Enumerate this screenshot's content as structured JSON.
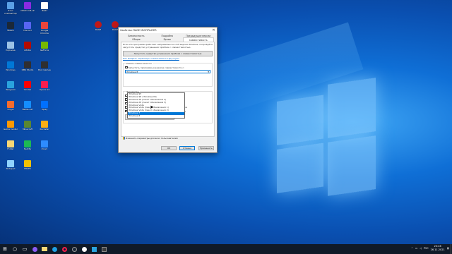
{
  "colors": {
    "accent": "#0078d7",
    "taskbar": "#101a28",
    "wallpaper": "#0a4fb0"
  },
  "desktop_icons": [
    {
      "label": "Этот компьютер",
      "color": "#5aa0e6",
      "icon": "computer-icon"
    },
    {
      "label": "CPUID CPU-Z",
      "color": "#8a2be2",
      "icon": "cpuz-icon"
    },
    {
      "label": "Файл",
      "color": "#ffffff",
      "icon": "file-icon"
    },
    {
      "label": "Steam",
      "color": "#1b2838",
      "icon": "steam-icon"
    },
    {
      "label": "Discord",
      "color": "#5865f2",
      "icon": "discord-icon"
    },
    {
      "label": "Google Chrome",
      "color": "#e8453c",
      "icon": "chrome-icon"
    },
    {
      "label": "Корзина",
      "color": "#9cc3e6",
      "icon": "recycle-bin-icon"
    },
    {
      "label": "Adobe",
      "color": "#b30b00",
      "icon": "adobe-icon"
    },
    {
      "label": "GeForce",
      "color": "#76b900",
      "icon": "nvidia-icon"
    },
    {
      "label": "Windows",
      "color": "#0078d7",
      "icon": "windows-icon"
    },
    {
      "label": "OBS Studio",
      "color": "#302e31",
      "icon": "obs-icon"
    },
    {
      "label": "Epic Games",
      "color": "#2f2f2f",
      "icon": "epic-icon"
    },
    {
      "label": "Telegram",
      "color": "#2aa3de",
      "icon": "telegram-icon"
    },
    {
      "label": "Yandex",
      "color": "#ff0000",
      "icon": "yandex-icon"
    },
    {
      "label": "Opera GX",
      "color": "#fa1e4e",
      "icon": "opera-icon"
    },
    {
      "label": "Origin",
      "color": "#f56c2d",
      "icon": "origin-icon"
    },
    {
      "label": "Battle.net",
      "color": "#148eff",
      "icon": "battlenet-icon"
    },
    {
      "label": "Uplay",
      "color": "#0070ff",
      "icon": "uplay-icon"
    },
    {
      "label": "Game Center",
      "color": "#ff9900",
      "icon": "gamecenter-icon"
    },
    {
      "label": "Minecraft",
      "color": "#5b8731",
      "icon": "minecraft-icon"
    },
    {
      "label": "Rockstar",
      "color": "#fcaf17",
      "icon": "rockstar-icon"
    },
    {
      "label": "Folder",
      "color": "#f8d775",
      "icon": "folder-icon"
    },
    {
      "label": "Spotify",
      "color": "#1db954",
      "icon": "spotify-icon"
    },
    {
      "label": "Zoom",
      "color": "#2d8cff",
      "icon": "zoom-icon"
    },
    {
      "label": "Notepad",
      "color": "#8fd3ff",
      "icon": "notepad-icon"
    },
    {
      "label": "FRAPS",
      "color": "#f2c200",
      "icon": "fraps-icon"
    }
  ],
  "dialog": {
    "title": "Свойства: RAGE MULTIPLAYER",
    "close": "✕",
    "tabs": [
      "Безопасность",
      "Подробно",
      "Предыдущие версии",
      "Общие",
      "Ярлык",
      "Совместимость"
    ],
    "intro": "Если эта программа работает неправильно в этой версии Windows, попробуйте запустить средство устранения проблем с совместимостью.",
    "troubleshoot_button": "Запустить средство устранения проблем с совместимостью",
    "how_link": "Как выбрать параметры совместимости вручную?",
    "group_title": "Режим совместимости",
    "compat_checkbox": "Запустить программу в режиме совместимости с:",
    "compat_check_mark": "✓",
    "selected_os": "Windows 8",
    "dropdown_options": [
      "Windows 95",
      "Windows 98 / Windows Me",
      "Windows XP (пакет обновления 2)",
      "Windows XP (пакет обновления 3)",
      "Windows Vista",
      "Windows Vista (пакет обновления 1)",
      "Windows Vista (пакет обновления 2)",
      "Windows 7",
      "Windows 8"
    ],
    "selected_index": 7,
    "settings_title": "Параметры",
    "options": [
      "Режим пониженной цветности",
      "Использовать разрешение экрана 640 × 480",
      "Отключить оптимизацию во весь экран",
      "Запускать эту программу от имени администратора",
      "Зарегистрировать эту программу для перезапуска"
    ],
    "dpi_button": "Изменить параметры высокого DPI",
    "all_users_button": "Изменить параметры для всех пользователей",
    "ok": "ОК",
    "cancel": "Отмена",
    "apply": "Применить"
  },
  "taskbar": {
    "start_icon": "⊞",
    "search_icon": "○",
    "task_icon": "▭",
    "lang": "РУС",
    "time": "20:46",
    "date": "26.11.2021"
  }
}
